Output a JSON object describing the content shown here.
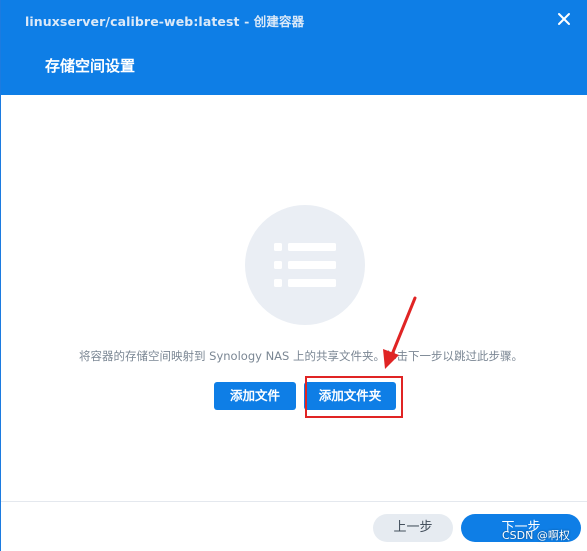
{
  "window": {
    "title": "linuxserver/calibre-web:latest - 创建容器",
    "section_title": "存储空间设置",
    "close_icon": "close-icon"
  },
  "content": {
    "illustration_icon": "list-icon",
    "hint": "将容器的存储空间映射到 Synology NAS 上的共享文件夹。单击下一步以跳过此步骤。",
    "add_file_label": "添加文件",
    "add_folder_label": "添加文件夹"
  },
  "annotation": {
    "arrow_icon": "red-arrow-icon",
    "highlight_color": "#e02424"
  },
  "footer": {
    "prev_label": "上一步",
    "next_label": "下一步"
  },
  "watermark": "CSDN @啊权",
  "colors": {
    "accent": "#0e7ee6",
    "hint_text": "#7b8794"
  }
}
